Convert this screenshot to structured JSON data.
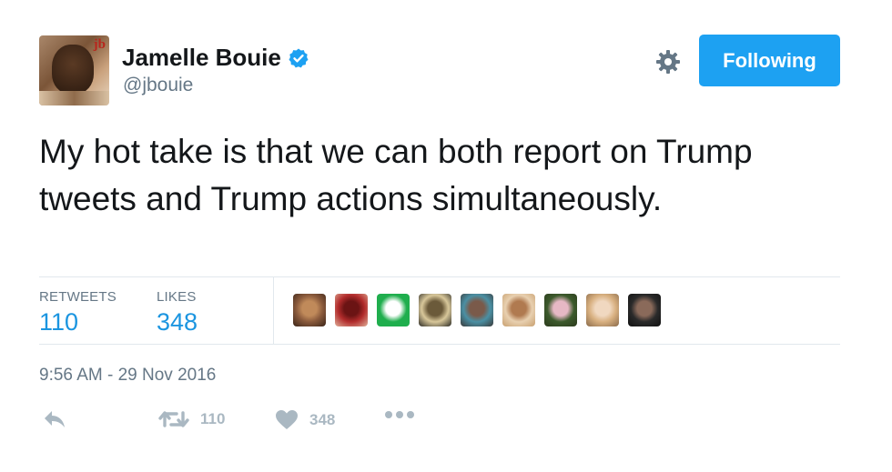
{
  "author": {
    "name": "Jamelle Bouie",
    "handle": "@jbouie",
    "avatar_text": "jb",
    "verified": true
  },
  "header": {
    "follow_label": "Following",
    "settings_icon": "gear-icon"
  },
  "tweet": {
    "text": "My hot take is that we can both report on Trump tweets and Trump actions simultaneously."
  },
  "stats": {
    "retweets_label": "RETWEETS",
    "retweets_value": "110",
    "likes_label": "LIKES",
    "likes_value": "348"
  },
  "likers": [
    {
      "name": "liker-1",
      "colors": [
        "#8a5a3c",
        "#c08a5a",
        "#3a2418"
      ]
    },
    {
      "name": "liker-2",
      "colors": [
        "#b22c2c",
        "#6b1414",
        "#e0b09a"
      ]
    },
    {
      "name": "liker-3",
      "colors": [
        "#1fae4d",
        "#ffffff",
        "#1fae4d"
      ]
    },
    {
      "name": "liker-4",
      "colors": [
        "#d8c79a",
        "#6b5a3a",
        "#2b2a24"
      ]
    },
    {
      "name": "liker-5",
      "colors": [
        "#4a90a4",
        "#7a5a4a",
        "#3a3a3a"
      ]
    },
    {
      "name": "liker-6",
      "colors": [
        "#e8d0b0",
        "#b07a50",
        "#c8a070"
      ]
    },
    {
      "name": "liker-7",
      "colors": [
        "#3c5a2c",
        "#e6b8c4",
        "#2c3a1c"
      ]
    },
    {
      "name": "liker-8",
      "colors": [
        "#d8b080",
        "#f0d8c0",
        "#8a6a4a"
      ]
    },
    {
      "name": "liker-9",
      "colors": [
        "#2a2a2a",
        "#8a6a5a",
        "#111111"
      ]
    }
  ],
  "timestamp": "9:56 AM - 29 Nov 2016",
  "actions": {
    "reply_icon": "reply-icon",
    "retweet_icon": "retweet-icon",
    "retweet_count": "110",
    "like_icon": "heart-icon",
    "like_count": "348",
    "more_icon": "more-icon"
  },
  "colors": {
    "accent": "#1da1f2",
    "link": "#1b95e0",
    "muted": "#657786",
    "icon": "#aab8c2",
    "border": "#e1e8ed"
  }
}
